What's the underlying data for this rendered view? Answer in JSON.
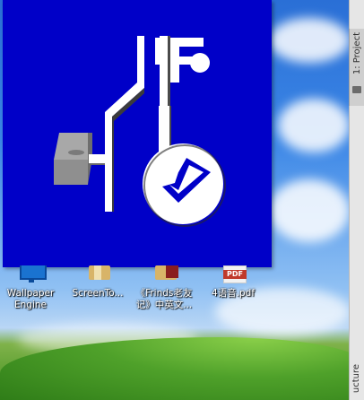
{
  "desktop": {
    "icons": [
      {
        "label_line1": "Wallpaper",
        "label_line2": "Engine",
        "icon": "monitor-icon"
      },
      {
        "label_line1": "ScreenTo...",
        "label_line2": "",
        "icon": "folder-icon"
      },
      {
        "label_line1": "《Frinds老友",
        "label_line2": "记》中英文...",
        "icon": "book-folder-icon"
      },
      {
        "label_line1": "4语音.pdf",
        "label_line2": "",
        "icon": "pdf-icon",
        "badge": "PDF"
      }
    ]
  },
  "side_panel": {
    "top_tab": "1: Project",
    "bottom_tab": "ucture"
  },
  "splash": {
    "background": "#0000c8",
    "logo": "fiddler-style-key-logo"
  }
}
